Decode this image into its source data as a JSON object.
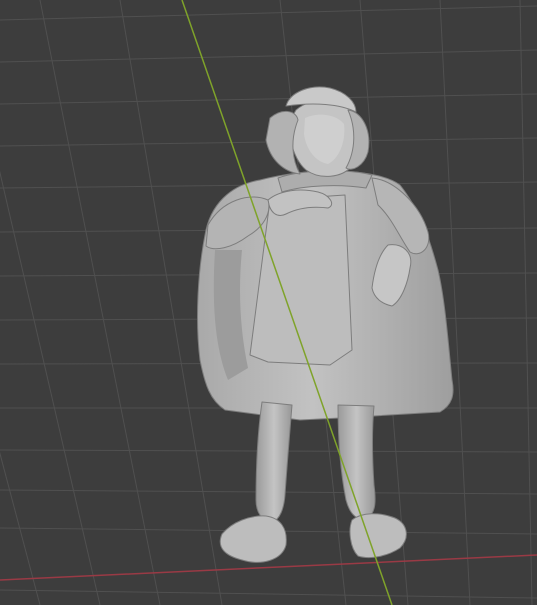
{
  "viewport": {
    "view": "3d-viewport",
    "background_color": "#3d3d3d",
    "grid_color": "#4f4f4f",
    "x_axis_color": "#9a3a45",
    "y_axis_color": "#7fa32a",
    "model": {
      "name": "statue-figure",
      "shading": "solid",
      "base_color": "#b8b8b8",
      "shade_color": "#8e8e8e",
      "highlight_color": "#d4d4d4"
    }
  }
}
